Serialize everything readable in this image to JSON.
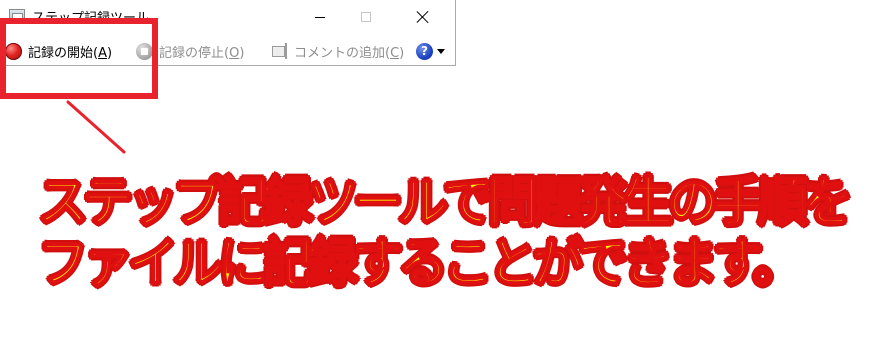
{
  "window": {
    "title": "ステップ記録ツール",
    "buttons": {
      "minimize": "minimize",
      "maximize": "maximize",
      "close": "close"
    }
  },
  "toolbar": {
    "start": {
      "label": "記録の開始(",
      "key": "A",
      "suffix": ")"
    },
    "stop": {
      "label": "記録の停止(",
      "key": "O",
      "suffix": ")"
    },
    "comment": {
      "label": "コメントの追加(",
      "key": "C",
      "suffix": ")"
    },
    "help_glyph": "?"
  },
  "annotation": {
    "line1": "ステップ記録ツールで問題発生の手順を",
    "line2": "ファイルに記録することができます。"
  },
  "colors": {
    "highlight": "#e8232e",
    "caption_fill": "#fff200",
    "caption_outline": "#e01010"
  }
}
